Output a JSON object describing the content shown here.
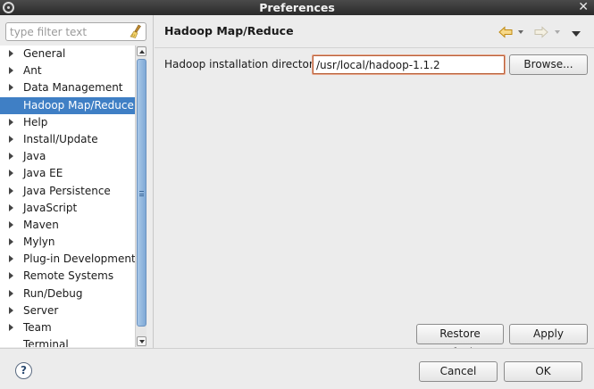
{
  "window": {
    "title": "Preferences",
    "close_glyph": "✕"
  },
  "filter": {
    "placeholder": "type filter text"
  },
  "tree": {
    "items": [
      {
        "label": "General",
        "expandable": true
      },
      {
        "label": "Ant",
        "expandable": true
      },
      {
        "label": "Data Management",
        "expandable": true
      },
      {
        "label": "Hadoop Map/Reduce",
        "expandable": false,
        "selected": true
      },
      {
        "label": "Help",
        "expandable": true
      },
      {
        "label": "Install/Update",
        "expandable": true
      },
      {
        "label": "Java",
        "expandable": true
      },
      {
        "label": "Java EE",
        "expandable": true
      },
      {
        "label": "Java Persistence",
        "expandable": true
      },
      {
        "label": "JavaScript",
        "expandable": true
      },
      {
        "label": "Maven",
        "expandable": true
      },
      {
        "label": "Mylyn",
        "expandable": true
      },
      {
        "label": "Plug-in Development",
        "expandable": true
      },
      {
        "label": "Remote Systems",
        "expandable": true
      },
      {
        "label": "Run/Debug",
        "expandable": true
      },
      {
        "label": "Server",
        "expandable": true
      },
      {
        "label": "Team",
        "expandable": true
      },
      {
        "label": "Terminal",
        "expandable": false
      }
    ]
  },
  "page": {
    "title": "Hadoop Map/Reduce",
    "dir_label": "Hadoop installation directory:",
    "dir_value": "/usr/local/hadoop-1.1.2",
    "browse_label": "Browse...",
    "restore_label": "Restore Defaults",
    "apply_label": "Apply"
  },
  "footer": {
    "help_glyph": "?",
    "cancel_label": "Cancel",
    "ok_label": "OK"
  },
  "colors": {
    "selection": "#3f7fc5",
    "input_error_border": "#b8603a",
    "nav_arrow": "#e0a020"
  }
}
